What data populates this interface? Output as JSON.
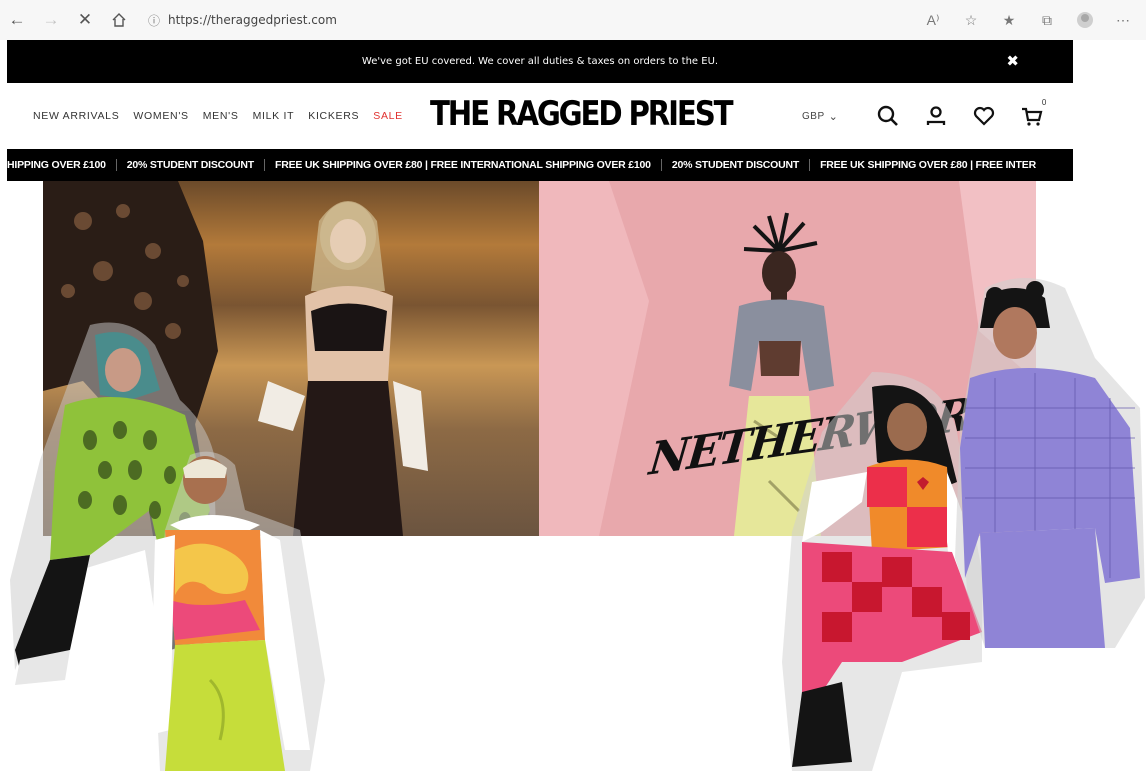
{
  "browser": {
    "url": "https://theraggedpriest.com",
    "icons": [
      "back-arrow-icon",
      "forward-arrow-icon",
      "close-icon",
      "home-icon",
      "info-icon",
      "read-aloud-icon",
      "add-favorite-icon",
      "favorites-icon",
      "collections-icon",
      "profile-icon",
      "more-icon"
    ]
  },
  "announcement": {
    "text": "We've got EU covered. We cover all duties & taxes on orders to the EU.",
    "close_label": "✖"
  },
  "nav": {
    "items": [
      "NEW ARRIVALS",
      "WOMEN'S",
      "MEN'S",
      "MILK IT",
      "KICKERS",
      "SALE"
    ],
    "sale_color": "#e0312f"
  },
  "logo": {
    "text": "THE RAGGED PRIEST"
  },
  "header_right": {
    "currency": "GBP",
    "cart_count": "0"
  },
  "ticker": {
    "items": [
      "HIPPING OVER £100",
      "20% STUDENT DISCOUNT",
      "FREE UK SHIPPING OVER £80 | FREE INTERNATIONAL SHIPPING OVER £100",
      "20% STUDENT DISCOUNT",
      "FREE UK SHIPPING OVER £80 | FREE INTER"
    ]
  },
  "hero": {
    "right_wordmark": "NETHERWORLD"
  },
  "colors": {
    "black": "#000000",
    "pink_bg": "#e8a8ac",
    "sale_red": "#e0312f"
  }
}
